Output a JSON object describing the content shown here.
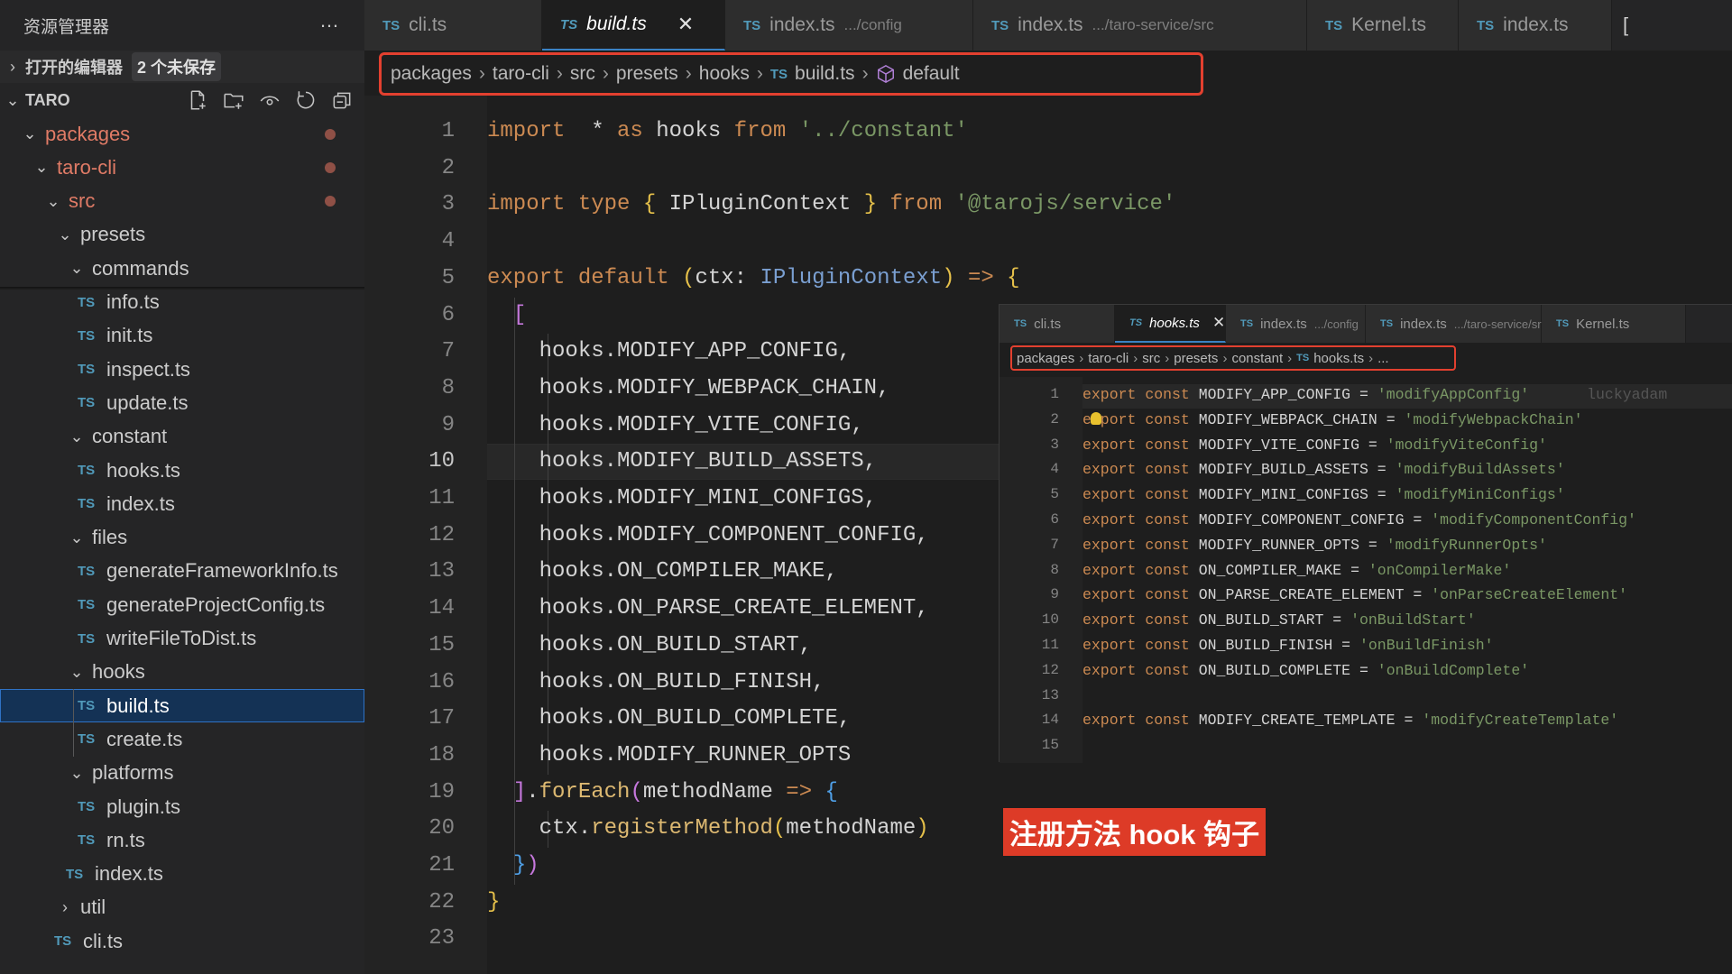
{
  "sidebar": {
    "title": "资源管理器",
    "more_icon": "…",
    "open_editors": {
      "label": "打开的编辑器",
      "badge": "2 个未保存"
    },
    "workspace": {
      "label": "TARO",
      "actions": [
        "new-file",
        "new-folder",
        "watch",
        "refresh",
        "collapse-all"
      ]
    },
    "tree": [
      {
        "label": "packages",
        "type": "folder",
        "expanded": true,
        "modified": true,
        "depth": 1
      },
      {
        "label": "taro-cli",
        "type": "folder",
        "expanded": true,
        "modified": true,
        "depth": 2
      },
      {
        "label": "src",
        "type": "folder",
        "expanded": true,
        "modified": true,
        "depth": 3
      },
      {
        "label": "presets",
        "type": "folder",
        "expanded": true,
        "depth": 4
      },
      {
        "label": "commands",
        "type": "folder",
        "expanded": true,
        "depth": 5
      },
      {
        "label": "info.ts",
        "type": "ts",
        "depth": 6
      },
      {
        "label": "init.ts",
        "type": "ts",
        "depth": 6
      },
      {
        "label": "inspect.ts",
        "type": "ts",
        "depth": 6
      },
      {
        "label": "update.ts",
        "type": "ts",
        "depth": 6
      },
      {
        "label": "constant",
        "type": "folder",
        "expanded": true,
        "depth": 5
      },
      {
        "label": "hooks.ts",
        "type": "ts",
        "depth": 6
      },
      {
        "label": "index.ts",
        "type": "ts",
        "depth": 6
      },
      {
        "label": "files",
        "type": "folder",
        "expanded": true,
        "depth": 5
      },
      {
        "label": "generateFrameworkInfo.ts",
        "type": "ts",
        "depth": 6
      },
      {
        "label": "generateProjectConfig.ts",
        "type": "ts",
        "depth": 6
      },
      {
        "label": "writeFileToDist.ts",
        "type": "ts",
        "depth": 6
      },
      {
        "label": "hooks",
        "type": "folder",
        "expanded": true,
        "depth": 5
      },
      {
        "label": "build.ts",
        "type": "ts",
        "depth": 6,
        "selected": true
      },
      {
        "label": "create.ts",
        "type": "ts",
        "depth": 6
      },
      {
        "label": "platforms",
        "type": "folder",
        "expanded": true,
        "depth": 5
      },
      {
        "label": "plugin.ts",
        "type": "ts",
        "depth": 6
      },
      {
        "label": "rn.ts",
        "type": "ts",
        "depth": 6
      },
      {
        "label": "index.ts",
        "type": "ts",
        "depth": 5
      },
      {
        "label": "util",
        "type": "folder",
        "expanded": false,
        "depth": 4
      },
      {
        "label": "cli.ts",
        "type": "ts",
        "depth": 4
      }
    ]
  },
  "tabs": [
    {
      "label": "cli.ts",
      "icon": "TS",
      "desc": ""
    },
    {
      "label": "build.ts",
      "icon": "TS",
      "desc": "",
      "active": true,
      "close": "✕"
    },
    {
      "label": "index.ts",
      "icon": "TS",
      "desc": ".../config"
    },
    {
      "label": "index.ts",
      "icon": "TS",
      "desc": ".../taro-service/src"
    },
    {
      "label": "Kernel.ts",
      "icon": "TS",
      "desc": ""
    },
    {
      "label": "index.ts",
      "icon": "TS",
      "desc": ""
    }
  ],
  "breadcrumb": [
    "packages",
    "taro-cli",
    "src",
    "presets",
    "hooks",
    "build.ts",
    "default"
  ],
  "editor": {
    "current_line": 10,
    "lines": [
      [
        [
          "k",
          "import"
        ],
        [
          "",
          "  * "
        ],
        [
          "k",
          "as"
        ],
        [
          "",
          " hooks "
        ],
        [
          "k",
          "from"
        ],
        [
          "",
          " "
        ],
        [
          "s",
          "'../constant'"
        ]
      ],
      [],
      [
        [
          "k",
          "import"
        ],
        [
          "",
          " "
        ],
        [
          "k",
          "type"
        ],
        [
          "",
          " "
        ],
        [
          "p1",
          "{"
        ],
        [
          "",
          " IPluginContext "
        ],
        [
          "p1",
          "}"
        ],
        [
          "",
          " "
        ],
        [
          "k",
          "from"
        ],
        [
          "",
          " "
        ],
        [
          "s",
          "'@tarojs/service'"
        ]
      ],
      [],
      [
        [
          "k",
          "export"
        ],
        [
          "",
          " "
        ],
        [
          "k",
          "default"
        ],
        [
          "",
          " "
        ],
        [
          "p1",
          "("
        ],
        [
          "",
          "ctx: "
        ],
        [
          "t",
          "IPluginContext"
        ],
        [
          "p1",
          ")"
        ],
        [
          "",
          " "
        ],
        [
          "k",
          "=>"
        ],
        [
          "",
          " "
        ],
        [
          "p1",
          "{"
        ]
      ],
      [
        [
          "",
          "  "
        ],
        [
          "p2",
          "["
        ]
      ],
      [
        [
          "",
          "    hooks.MODIFY_APP_CONFIG,"
        ]
      ],
      [
        [
          "",
          "    hooks.MODIFY_WEBPACK_CHAIN,"
        ]
      ],
      [
        [
          "",
          "    hooks.MODIFY_VITE_CONFIG,"
        ]
      ],
      [
        [
          "",
          "    hooks.MODIFY_BUILD_ASSETS,"
        ]
      ],
      [
        [
          "",
          "    hooks.MODIFY_MINI_CONFIGS,"
        ]
      ],
      [
        [
          "",
          "    hooks.MODIFY_COMPONENT_CONFIG,"
        ]
      ],
      [
        [
          "",
          "    hooks.ON_COMPILER_MAKE,"
        ]
      ],
      [
        [
          "",
          "    hooks.ON_PARSE_CREATE_ELEMENT,"
        ]
      ],
      [
        [
          "",
          "    hooks.ON_BUILD_START,"
        ]
      ],
      [
        [
          "",
          "    hooks.ON_BUILD_FINISH,"
        ]
      ],
      [
        [
          "",
          "    hooks.ON_BUILD_COMPLETE,"
        ]
      ],
      [
        [
          "",
          "    hooks.MODIFY_RUNNER_OPTS"
        ]
      ],
      [
        [
          "",
          "  "
        ],
        [
          "p2",
          "]"
        ],
        [
          "",
          "."
        ],
        [
          "f",
          "forEach"
        ],
        [
          "p2",
          "("
        ],
        [
          "",
          "methodName "
        ],
        [
          "k",
          "=>"
        ],
        [
          "",
          " "
        ],
        [
          "p3",
          "{"
        ]
      ],
      [
        [
          "",
          "    ctx."
        ],
        [
          "f",
          "registerMethod"
        ],
        [
          "p1",
          "("
        ],
        [
          "",
          "methodName"
        ],
        [
          "p1",
          ")"
        ]
      ],
      [
        [
          "",
          "  "
        ],
        [
          "p3",
          "}"
        ],
        [
          "p2",
          ")"
        ]
      ],
      [
        [
          "p1",
          "}"
        ]
      ],
      []
    ]
  },
  "peek": {
    "tabs": [
      {
        "label": "cli.ts",
        "icon": "TS",
        "desc": ""
      },
      {
        "label": "hooks.ts",
        "icon": "TS",
        "desc": "",
        "active": true,
        "close": "✕"
      },
      {
        "label": "index.ts",
        "icon": "TS",
        "desc": ".../config"
      },
      {
        "label": "index.ts",
        "icon": "TS",
        "desc": ".../taro-service/src"
      },
      {
        "label": "Kernel.ts",
        "icon": "TS",
        "desc": ""
      }
    ],
    "breadcrumb": [
      "packages",
      "taro-cli",
      "src",
      "presets",
      "constant",
      "hooks.ts",
      "..."
    ],
    "blame": "luckyadam",
    "lines": [
      [
        "MODIFY_APP_CONFIG",
        "'modifyAppConfig'"
      ],
      [
        "MODIFY_WEBPACK_CHAIN",
        "'modifyWebpackChain'"
      ],
      [
        "MODIFY_VITE_CONFIG",
        "'modifyViteConfig'"
      ],
      [
        "MODIFY_BUILD_ASSETS",
        "'modifyBuildAssets'"
      ],
      [
        "MODIFY_MINI_CONFIGS",
        "'modifyMiniConfigs'"
      ],
      [
        "MODIFY_COMPONENT_CONFIG",
        "'modifyComponentConfig'"
      ],
      [
        "MODIFY_RUNNER_OPTS",
        "'modifyRunnerOpts'"
      ],
      [
        "ON_COMPILER_MAKE",
        "'onCompilerMake'"
      ],
      [
        "ON_PARSE_CREATE_ELEMENT",
        "'onParseCreateElement'"
      ],
      [
        "ON_BUILD_START",
        "'onBuildStart'"
      ],
      [
        "ON_BUILD_FINISH",
        "'onBuildFinish'"
      ],
      [
        "ON_BUILD_COMPLETE",
        "'onBuildComplete'"
      ],
      null,
      [
        "MODIFY_CREATE_TEMPLATE",
        "'modifyCreateTemplate'"
      ],
      null
    ],
    "keywords": [
      "export",
      "const"
    ]
  },
  "annotation": "注册方法 hook 钩子",
  "colors": {
    "accent": "#3b82c4",
    "highlight_box": "#e3402f",
    "annotation_bg": "#dd3b27",
    "ts_icon": "#519aba",
    "modified": "#e07b66"
  }
}
